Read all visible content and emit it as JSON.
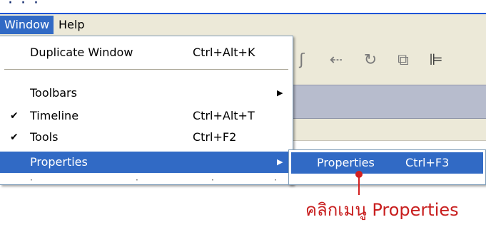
{
  "top_fragment": "ู้                  ·                       ·               ·",
  "menubar": {
    "window_label": "Window",
    "help_label": "Help"
  },
  "menu": {
    "items": [
      {
        "label": "Duplicate Window",
        "shortcut": "Ctrl+Alt+K"
      },
      {
        "label": "Toolbars",
        "submenu_arrow": "▶"
      },
      {
        "label": "Timeline",
        "shortcut": "Ctrl+Alt+T",
        "check": "✔"
      },
      {
        "label": "Tools",
        "shortcut": "Ctrl+F2",
        "check": "✔"
      },
      {
        "label": "Properties",
        "submenu_arrow": "▶"
      }
    ]
  },
  "submenu": {
    "label": "Properties",
    "shortcut": "Ctrl+F3"
  },
  "annotation": "คลิกเมนู Properties",
  "colors": {
    "highlight": "#316ac5",
    "annotation": "#c81e1e",
    "menubar": "#ece9d8"
  },
  "icons": [
    "pen-tool-icon",
    "subselect-icon",
    "rotate-icon",
    "scale-icon",
    "align-icon"
  ]
}
